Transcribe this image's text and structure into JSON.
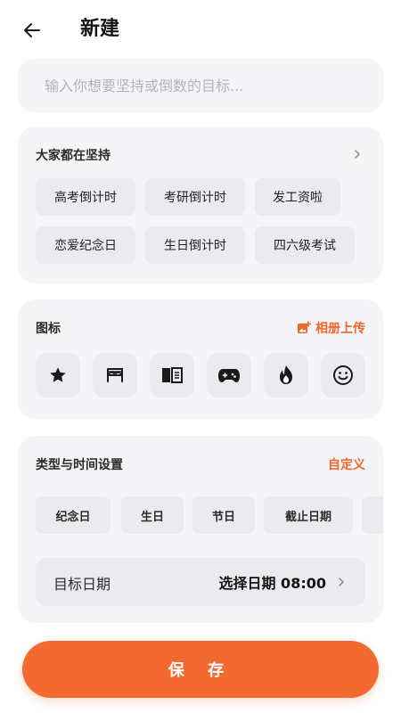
{
  "header": {
    "title": "新建"
  },
  "search": {
    "placeholder": "输入你想要坚持或倒数的目标..."
  },
  "popular": {
    "title": "大家都在坚持",
    "items": [
      "高考倒计时",
      "考研倒计时",
      "发工资啦",
      "恋爱纪念日",
      "生日倒计时",
      "四六级考试"
    ]
  },
  "icons": {
    "title": "图标",
    "upload_label": "相册上传",
    "items": [
      "star-icon",
      "bed-icon",
      "book-icon",
      "gamepad-icon",
      "fire-icon",
      "smile-icon"
    ]
  },
  "type_settings": {
    "title": "类型与时间设置",
    "custom_label": "自定义",
    "types": [
      "纪念日",
      "生日",
      "节日",
      "截止日期"
    ],
    "date_label": "目标日期",
    "date_value": "选择日期 08:00"
  },
  "save": {
    "label": "保 存"
  },
  "colors": {
    "accent": "#f26a30",
    "card_bg": "#f5f5f7",
    "chip_bg": "#ebebef"
  }
}
